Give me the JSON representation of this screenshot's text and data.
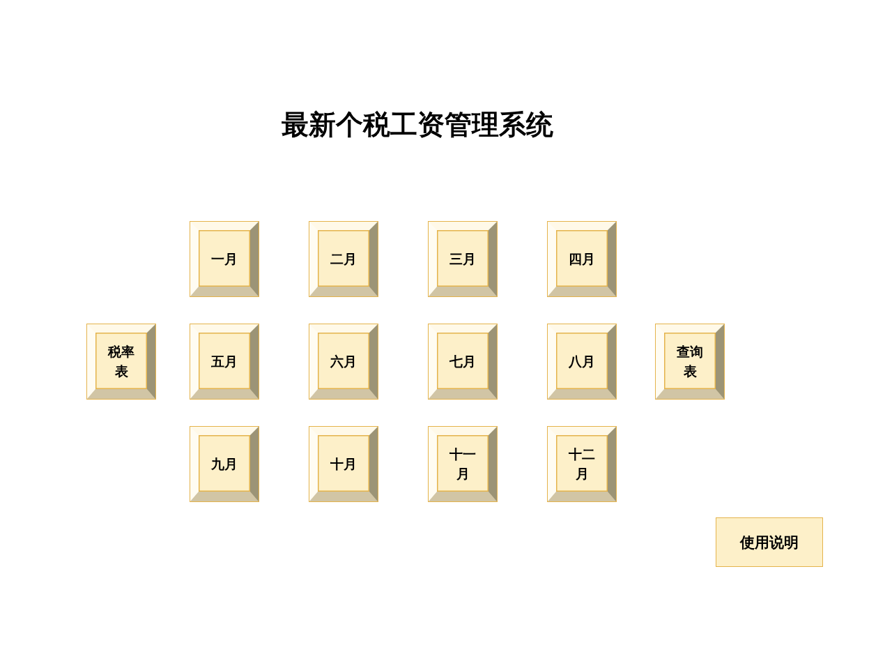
{
  "title": "最新个税工资管理系统",
  "rows": [
    {
      "buttons": [
        {
          "label": "一月"
        },
        {
          "label": "二月"
        },
        {
          "label": "三月"
        },
        {
          "label": "四月"
        }
      ]
    },
    {
      "buttons": [
        {
          "label": "税率表"
        },
        {
          "label": "五月"
        },
        {
          "label": "六月"
        },
        {
          "label": "七月"
        },
        {
          "label": "八月"
        },
        {
          "label": "查询表"
        }
      ]
    },
    {
      "buttons": [
        {
          "label": "九月"
        },
        {
          "label": "十月"
        },
        {
          "label": "十一月"
        },
        {
          "label": "十二月"
        }
      ]
    }
  ],
  "help_button": {
    "label": "使用说明"
  }
}
